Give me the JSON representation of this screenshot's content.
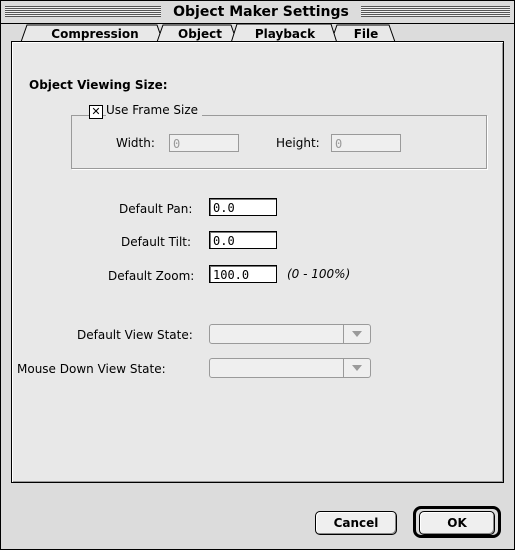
{
  "window": {
    "title": "Object Maker Settings"
  },
  "tabs": [
    {
      "label": "Compression",
      "active": false
    },
    {
      "label": "Object",
      "active": false
    },
    {
      "label": "Playback",
      "active": true
    },
    {
      "label": "File",
      "active": false
    }
  ],
  "section": {
    "title": "Object Viewing Size:",
    "use_frame_size": {
      "label": "Use Frame Size",
      "checked": true,
      "mark": "✕"
    },
    "width": {
      "label": "Width:",
      "value": "0"
    },
    "height": {
      "label": "Height:",
      "value": "0"
    }
  },
  "pan": {
    "label": "Default Pan:",
    "value": "0.0"
  },
  "tilt": {
    "label": "Default Tilt:",
    "value": "0.0"
  },
  "zoom": {
    "label": "Default Zoom:",
    "value": "100.0",
    "hint": "(0 - 100%)"
  },
  "view_state": {
    "label": "Default View State:",
    "value": ""
  },
  "mouse_down_state": {
    "label": "Mouse Down View State:",
    "value": ""
  },
  "buttons": {
    "cancel": "Cancel",
    "ok": "OK"
  },
  "icons": {
    "popup_arrow": "chevron-down-icon"
  }
}
